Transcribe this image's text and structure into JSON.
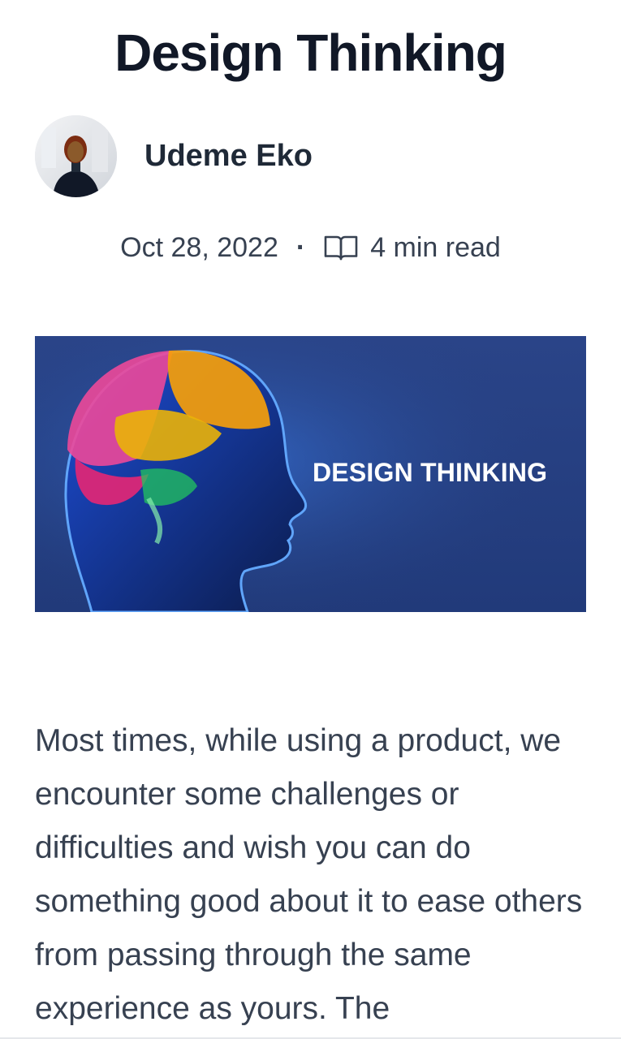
{
  "article": {
    "title": "Design Thinking",
    "author": {
      "name": "Udeme Eko",
      "avatar_icon": "author-avatar-photo"
    },
    "meta": {
      "date": "Oct 28, 2022",
      "separator": "·",
      "read_icon": "book-open-icon",
      "read_time": "4 min read"
    },
    "hero": {
      "image_icon": "brain-head-illustration",
      "overlay_text": "DESIGN THINKING",
      "background_color": "#243f80"
    },
    "body": "Most times, while using a product, we encounter some challenges or difficulties and wish you can do something good about it to ease others from passing through the same experience as yours. The"
  },
  "colors": {
    "title": "#111827",
    "text": "#374151",
    "accent_blue": "#243f80"
  }
}
